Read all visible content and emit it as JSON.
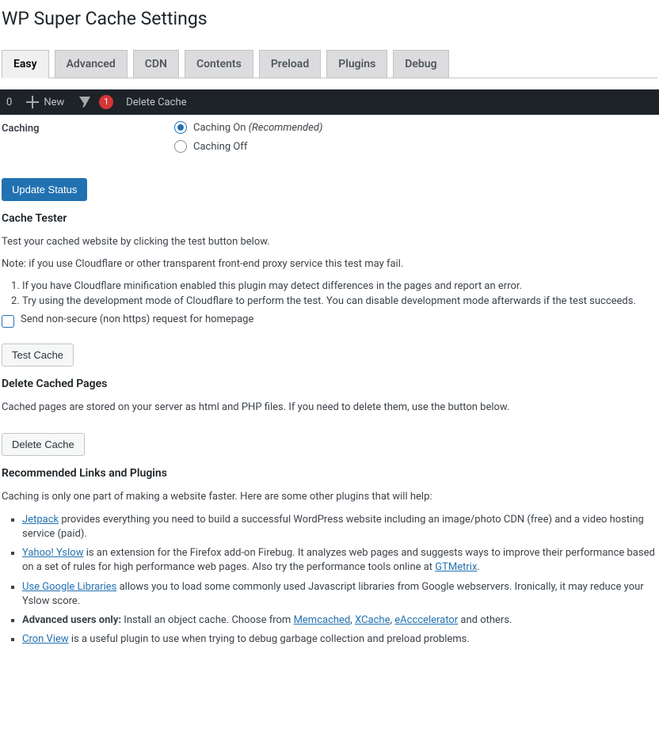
{
  "page_title": "WP Super Cache Settings",
  "tabs": {
    "items": [
      {
        "label": "Easy",
        "active": true
      },
      {
        "label": "Advanced"
      },
      {
        "label": "CDN"
      },
      {
        "label": "Contents"
      },
      {
        "label": "Preload"
      },
      {
        "label": "Plugins"
      },
      {
        "label": "Debug"
      }
    ]
  },
  "adminbar": {
    "left_num": "0",
    "new_label": "New",
    "notify_count": "1",
    "delete_cache": "Delete Cache"
  },
  "caching": {
    "label": "Caching",
    "on_label": "Caching On ",
    "on_note": "(Recommended)",
    "off_label": "Caching Off",
    "update_btn": "Update Status"
  },
  "tester": {
    "heading": "Cache Tester",
    "p1": "Test your cached website by clicking the test button below.",
    "p2": "Note: if you use Cloudflare or other transparent front-end proxy service this test may fail.",
    "li1": "If you have Cloudflare minification enabled this plugin may detect differences in the pages and report an error.",
    "li2": "Try using the development mode of Cloudflare to perform the test. You can disable development mode afterwards if the test succeeds.",
    "cb_label": "Send non-secure (non https) request for homepage",
    "test_btn": "Test Cache"
  },
  "delete": {
    "heading": "Delete Cached Pages",
    "p1": "Cached pages are stored on your server as html and PHP files. If you need to delete them, use the button below.",
    "btn": "Delete Cache"
  },
  "rec": {
    "heading": "Recommended Links and Plugins",
    "intro": "Caching is only one part of making a website faster. Here are some other plugins that will help:",
    "jetpack": "Jetpack",
    "jetpack_txt": " provides everything you need to build a successful WordPress website including an image/photo CDN (free) and a video hosting service (paid).",
    "yslow": "Yahoo! Yslow",
    "yslow_txt": " is an extension for the Firefox add-on Firebug. It analyzes web pages and suggests ways to improve their performance based on a set of rules for high performance web pages. Also try the performance tools online at ",
    "gtmetrix": "GTMetrix",
    "period": ".",
    "google": "Use Google Libraries",
    "google_txt": " allows you to load some commonly used Javascript libraries from Google webservers. Ironically, it may reduce your Yslow score.",
    "adv_prefix": "Advanced users only:",
    "adv_txt": " Install an object cache. Choose from ",
    "memcached": "Memcached",
    "comma": ", ",
    "xcache": "XCache",
    "eacc": "eAcccelerator",
    "adv_suffix": " and others.",
    "cron": "Cron View",
    "cron_txt": " is a useful plugin to use when trying to debug garbage collection and preload problems."
  }
}
